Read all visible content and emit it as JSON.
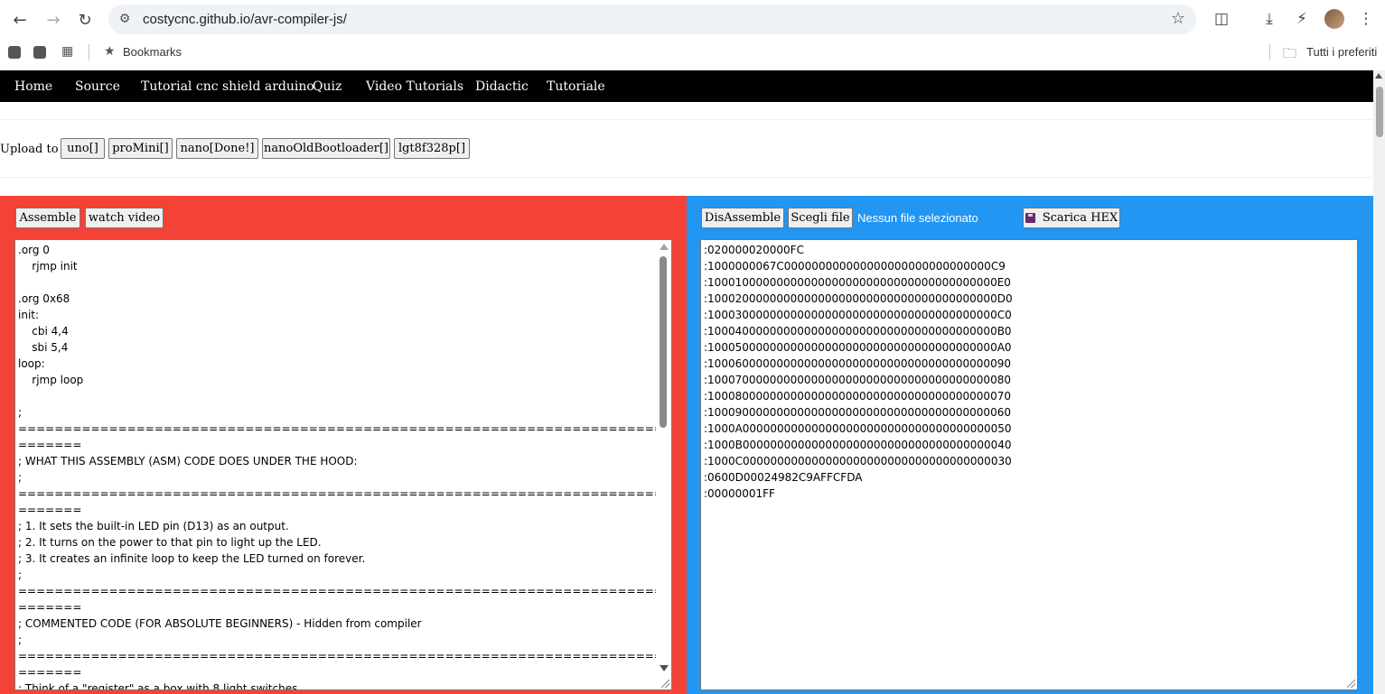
{
  "browser": {
    "url": "costycnc.github.io/avr-compiler-js/",
    "bookmarks_label": "Bookmarks",
    "all_favorites_label": "Tutti i preferiti",
    "icons": [
      "back-icon",
      "forward-icon",
      "reload-icon",
      "site-settings-icon",
      "star-icon",
      "extensions-icon",
      "download-icon",
      "performance-icon",
      "menu-icon"
    ]
  },
  "nav": {
    "items": [
      "Home",
      "Source",
      "Tutorial cnc shield arduino",
      "Quiz",
      "Video Tutorials",
      "Didactic",
      "Tutoriale"
    ]
  },
  "upload": {
    "label": "Upload to :",
    "buttons": [
      "uno[]",
      "proMini[]",
      "nano[Done!]",
      "nanoOldBootloader[]",
      "lgt8f328p[]"
    ]
  },
  "left_panel": {
    "assemble_label": "Assemble",
    "watch_video_label": "watch video",
    "color": "#f44336",
    "code": ".org 0\n    rjmp init\n\n.org 0x68\ninit:\n    cbi 4,4\n    sbi 5,4\nloop:\n    rjmp loop\n\n;\n=========================================================================\n=======\n; WHAT THIS ASSEMBLY (ASM) CODE DOES UNDER THE HOOD:\n;\n=========================================================================\n=======\n; 1. It sets the built-in LED pin (D13) as an output.\n; 2. It turns on the power to that pin to light up the LED.\n; 3. It creates an infinite loop to keep the LED turned on forever.\n;\n=========================================================================\n=======\n; COMMENTED CODE (FOR ABSOLUTE BEGINNERS) - Hidden from compiler\n;\n=========================================================================\n=======\n; Think of a \"register\" as a box with 8 light switches."
  },
  "right_panel": {
    "disassemble_label": "DisAssemble",
    "choose_file_label": "Scegli file",
    "no_file_label": "Nessun file selezionato",
    "download_hex_label": "Scarica HEX",
    "color": "#2196f3",
    "hex": ":020000020000FC\n:1000000067C000000000000000000000000000000C9\n:100010000000000000000000000000000000000000E0\n:100020000000000000000000000000000000000000D0\n:100030000000000000000000000000000000000000C0\n:100040000000000000000000000000000000000000B0\n:100050000000000000000000000000000000000000A0\n:10006000000000000000000000000000000000000090\n:10007000000000000000000000000000000000000080\n:10008000000000000000000000000000000000000070\n:10009000000000000000000000000000000000000060\n:1000A000000000000000000000000000000000000050\n:1000B000000000000000000000000000000000000040\n:1000C000000000000000000000000000000000000030\n:0600D00024982C9AFFCFDA\n:00000001FF"
  }
}
